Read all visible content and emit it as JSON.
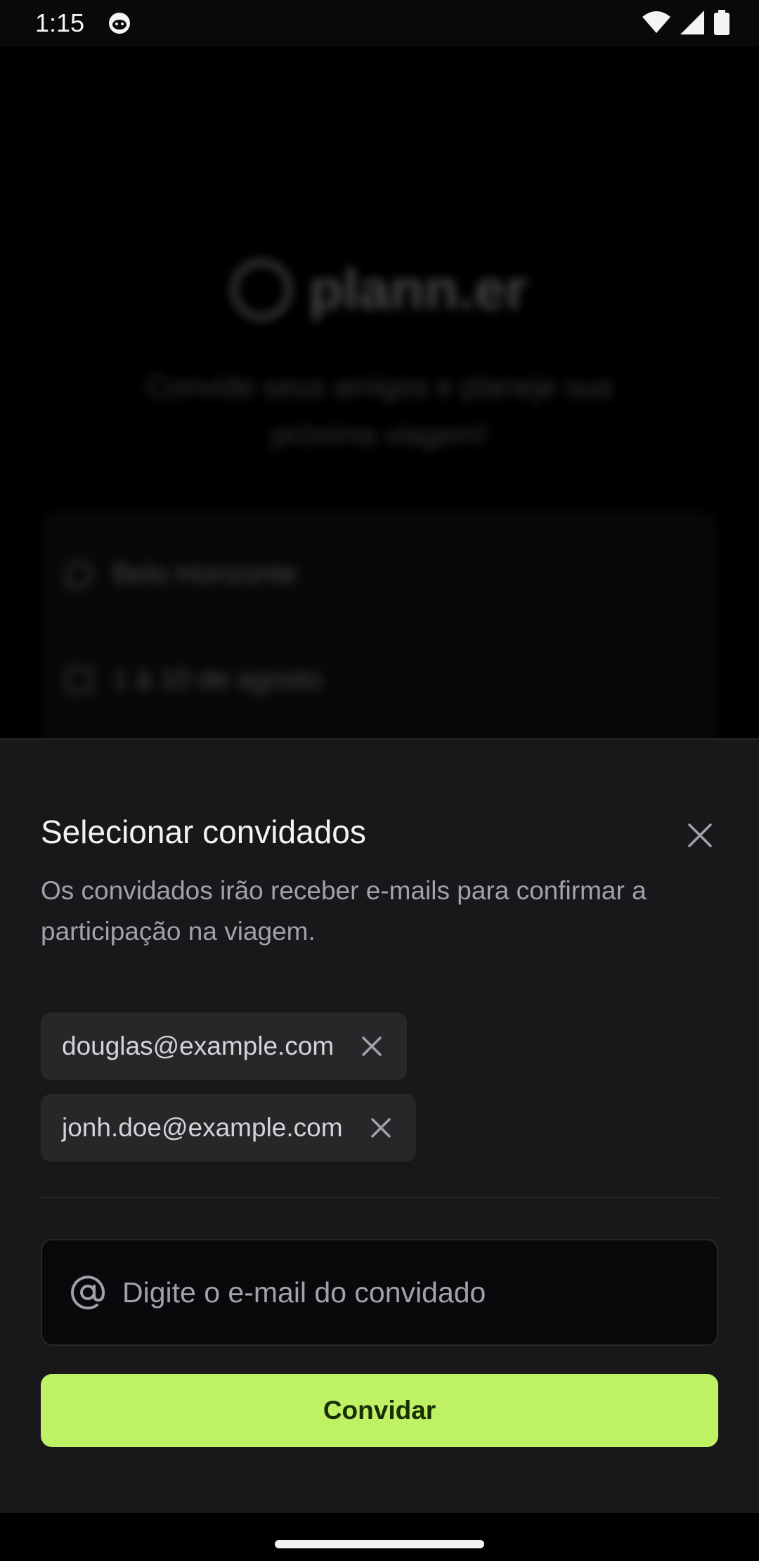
{
  "status_bar": {
    "time": "1:15",
    "icons": [
      "cat-app-icon",
      "wifi-icon",
      "signal-icon",
      "battery-icon"
    ]
  },
  "background": {
    "app_name": "plann.er",
    "tagline": "Convide seus amigos e planeje sua próxima viagem!",
    "destination": "Belo Horizonte",
    "dates": "1 à 10 de agosto"
  },
  "sheet": {
    "title": "Selecionar convidados",
    "description": "Os convidados irão receber e-mails para confirmar a participação na viagem.",
    "guests": [
      {
        "email": "douglas@example.com"
      },
      {
        "email": "jonh.doe@example.com"
      }
    ],
    "email_input": {
      "value": "",
      "placeholder": "Digite o e-mail do convidado"
    },
    "invite_label": "Convidar"
  },
  "colors": {
    "accent": "#bef264",
    "sheet_bg": "#18181b",
    "chip_bg": "#27272a",
    "input_bg": "#09090b"
  }
}
